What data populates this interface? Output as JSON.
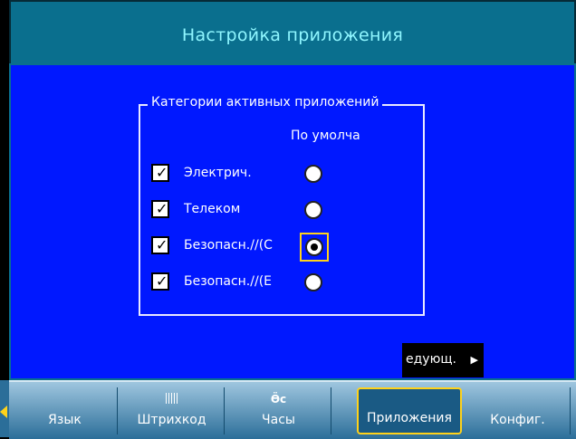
{
  "window": {
    "title": "Настройка приложения"
  },
  "group": {
    "legend": "Категории активных приложений",
    "column_header": "По умолча",
    "items": [
      {
        "label": "Электрич.",
        "checked": true,
        "default": false
      },
      {
        "label": "Телеком",
        "checked": true,
        "default": false
      },
      {
        "label": "Безопасн.//(С",
        "checked": true,
        "default": true,
        "focused": true
      },
      {
        "label": "Безопасн.//(Е",
        "checked": true,
        "default": false
      }
    ]
  },
  "next_button": {
    "label": "едующ.",
    "icon": "arrow-right-icon"
  },
  "tabs": [
    {
      "label": "Язык",
      "icon": ""
    },
    {
      "label": "Штрихкод",
      "icon": "barcode-icon"
    },
    {
      "label": "Часы",
      "icon": "clock-icon",
      "icon_text": "Ӫс"
    },
    {
      "label": "Приложения",
      "icon": "",
      "active": true
    },
    {
      "label": "Конфиг.",
      "icon": ""
    }
  ],
  "colors": {
    "title_bar": "#0a6f8e",
    "title_text": "#8ff6ff",
    "main_bg": "#0018ff",
    "focus": "#ffd21a"
  }
}
